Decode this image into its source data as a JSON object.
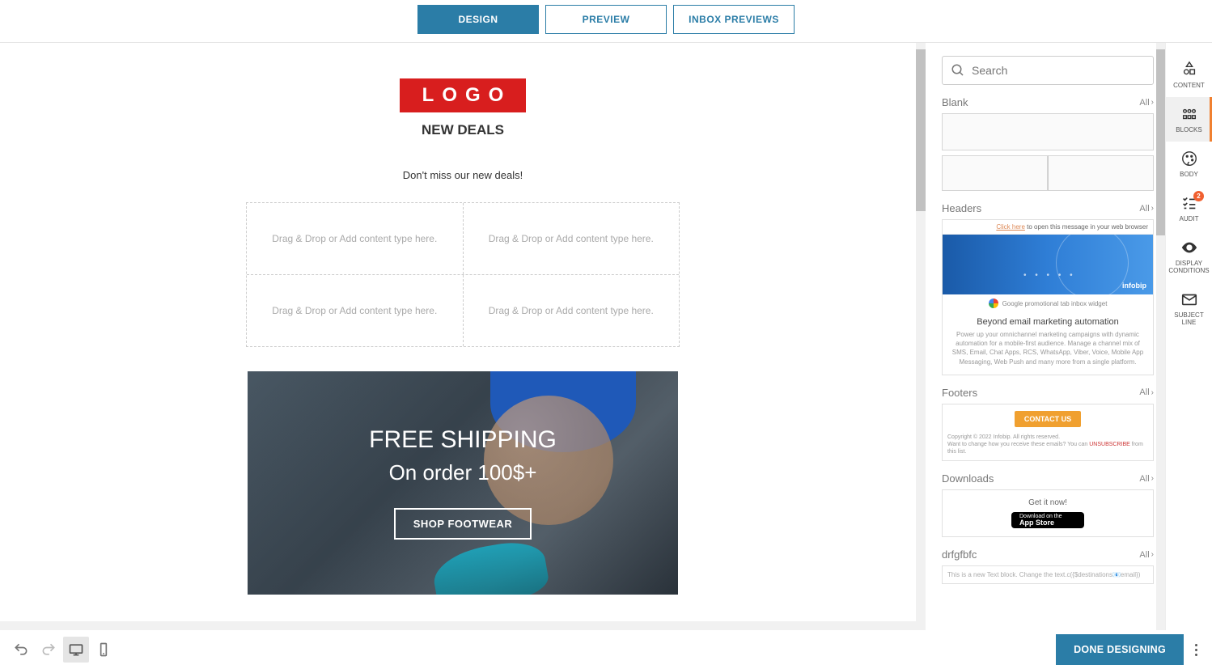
{
  "tabs": {
    "design": "DESIGN",
    "preview": "PREVIEW",
    "inbox": "INBOX PREVIEWS"
  },
  "email": {
    "logo_text": "LOGO",
    "headline": "NEW DEALS",
    "subline": "Don't miss our new deals!",
    "drop_placeholder": "Drag & Drop or Add content type here.",
    "hero_line1": "FREE SHIPPING",
    "hero_line2": "On order 100$+",
    "hero_cta": "SHOP FOOTWEAR"
  },
  "sidebar": {
    "search_placeholder": "Search",
    "all_label": "All",
    "sections": {
      "blank": "Blank",
      "headers": "Headers",
      "footers": "Footers",
      "downloads": "Downloads",
      "custom": "drfgfbfc"
    },
    "header_block": {
      "click_here": "Click here",
      "click_suffix": " to open this message in your web browser",
      "brand": "infobip",
      "g_caption": "Google promotional tab inbox widget",
      "title": "Beyond email marketing automation",
      "desc": "Power up your omnichannel marketing campaigns with dynamic automation for a mobile-first audience. Manage a channel mix of SMS, Email, Chat Apps, RCS, WhatsApp, Viber, Voice, Mobile App Messaging, Web Push and many more from a single platform."
    },
    "footer_block": {
      "contact": "CONTACT US",
      "copyright": "Copyright © 2022 Infobip. All rights reserved.",
      "line2a": "Want to change how you receive these emails? You can ",
      "unsub": "UNSUBSCRIBE",
      "line2b": " from this list."
    },
    "download_block": {
      "title": "Get it now!",
      "store_small": "Download on the",
      "store_big": "App Store"
    },
    "custom_block": {
      "text": "This is a new Text block. Change the text.c({$destinations📧email})"
    }
  },
  "rail": {
    "content": "CONTENT",
    "blocks": "BLOCKS",
    "body": "BODY",
    "audit": "AUDIT",
    "audit_badge": "2",
    "display": "DISPLAY CONDITIONS",
    "subject": "SUBJECT LINE"
  },
  "bottom": {
    "done": "DONE DESIGNING"
  }
}
